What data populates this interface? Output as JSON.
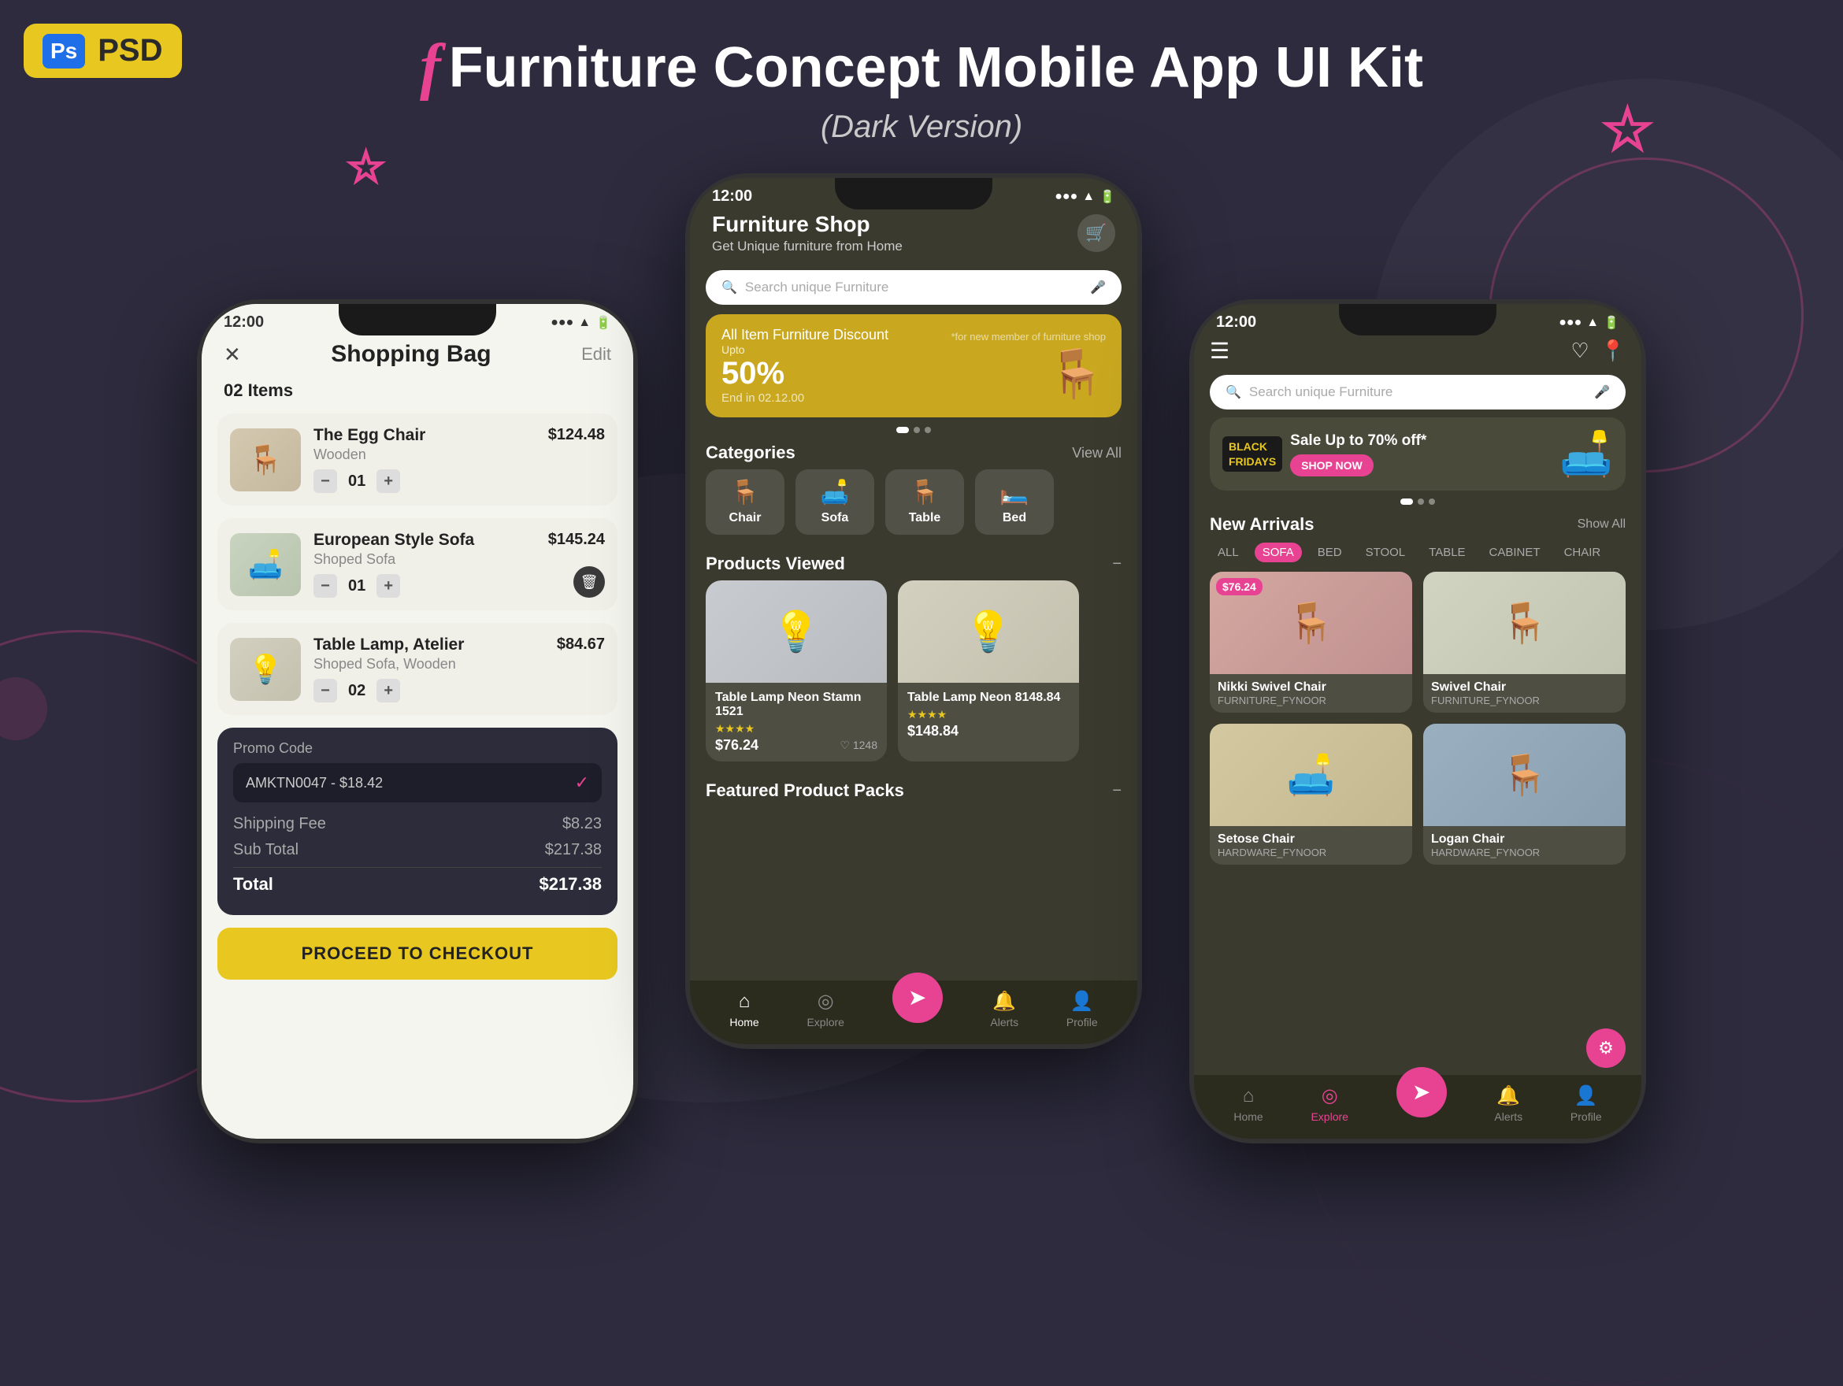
{
  "page": {
    "badge": {
      "ps_label": "Ps",
      "psd_label": "PSD"
    },
    "header": {
      "f_char": "f",
      "title": "Furniture Concept Mobile App UI Kit",
      "subtitle": "(Dark Version)"
    },
    "stars": [
      "☆",
      "☆"
    ],
    "background_color": "#2d2b3d"
  },
  "phone1": {
    "status": {
      "time": "12:00",
      "icons": "▲ ⋮ ▼ 🔋"
    },
    "title": "Shopping Bag",
    "edit_label": "Edit",
    "items_count": "02 Items",
    "items": [
      {
        "name": "The Egg Chair",
        "sub": "Wooden",
        "price": "$124.48",
        "qty": "01",
        "emoji": "🪑"
      },
      {
        "name": "European Style Sofa",
        "sub": "Shoped Sofa",
        "price": "$145.24",
        "qty": "01",
        "emoji": "🛋️"
      },
      {
        "name": "Table Lamp, Atelier",
        "sub": "Shoped Sofa, Wooden",
        "price": "$84.67",
        "qty": "02",
        "emoji": "💡"
      }
    ],
    "promo_label": "Promo Code",
    "promo_code": "AMKTN0047 - $18.42",
    "shipping_label": "Shipping Fee",
    "shipping_val": "$8.23",
    "subtotal_label": "Sub Total",
    "subtotal_val": "$217.38",
    "total_label": "Total",
    "total_val": "$217.38",
    "checkout_btn": "PROCEED TO CHECKOUT"
  },
  "phone2": {
    "status": {
      "time": "12:00",
      "icons": "▲ ⋮ 🔋"
    },
    "title": "Furniture Shop",
    "subtitle": "Get Unique furniture from Home",
    "search_placeholder": "Search unique Furniture",
    "banner": {
      "all_item": "All Item Furniture Discount",
      "upto": "Upto",
      "percent": "50%",
      "end": "End in 02.12.00",
      "note": "*for new member of furniture shop"
    },
    "categories_label": "Categories",
    "view_all": "View All",
    "categories": [
      {
        "label": "Chair",
        "icon": "🪑"
      },
      {
        "label": "Sofa",
        "icon": "🛋️"
      },
      {
        "label": "Table",
        "icon": "🪑"
      },
      {
        "label": "Bed",
        "icon": "🛏️"
      }
    ],
    "products_viewed_label": "Products Viewed",
    "products": [
      {
        "name": "Table Lamp Neon Stamn 1521",
        "stars": "★★★★",
        "price": "$76.24",
        "likes": "♡ 1248",
        "emoji": "💡"
      },
      {
        "name": "Table Lamp Neon 8148.84",
        "stars": "★★★★",
        "price": "$148.84",
        "likes": "",
        "emoji": "💡"
      }
    ],
    "featured_label": "Featured Product Packs",
    "nav": {
      "home": "Home",
      "explore": "Explore",
      "alerts": "Alerts",
      "profile": "Profile"
    }
  },
  "phone3": {
    "status": {
      "time": "12:00",
      "icons": "▲ ⋮ 🔋"
    },
    "search_placeholder": "Search unique Furniture",
    "banner": {
      "black_friday": "BLACK\nFRIDAYS",
      "sale": "Sale Up to 70% off*",
      "shop_now": "SHOP NOW"
    },
    "new_arrivals_label": "New Arrivals",
    "show_all": "Show All",
    "filter_tabs": [
      "ALL",
      "SOFA",
      "BED",
      "STOOL",
      "TABLE",
      "CABINET",
      "CHAIR"
    ],
    "active_tab": "SOFA",
    "products": [
      {
        "name": "Nikki Swivel Chair",
        "sub": "FURNITURE_FYNOOR",
        "price": "$76.24",
        "emoji": "🪑",
        "color": "img-nswivel"
      },
      {
        "name": "Swivel Chair",
        "sub": "FURNITURE_FYNOOR",
        "price": "",
        "emoji": "🪑",
        "color": "img-swivel"
      },
      {
        "name": "Setose Chair",
        "sub": "HARDWARE_FYNOOR",
        "price": "",
        "emoji": "🛋️",
        "color": "img-setose"
      },
      {
        "name": "Logan Chair",
        "sub": "HARDWARE_FYNOOR",
        "price": "",
        "emoji": "🪑",
        "color": "img-logan"
      }
    ],
    "nav": {
      "home": "Home",
      "explore": "Explore",
      "alerts": "Alerts",
      "profile": "Profile"
    },
    "active_nav": "Explore"
  }
}
